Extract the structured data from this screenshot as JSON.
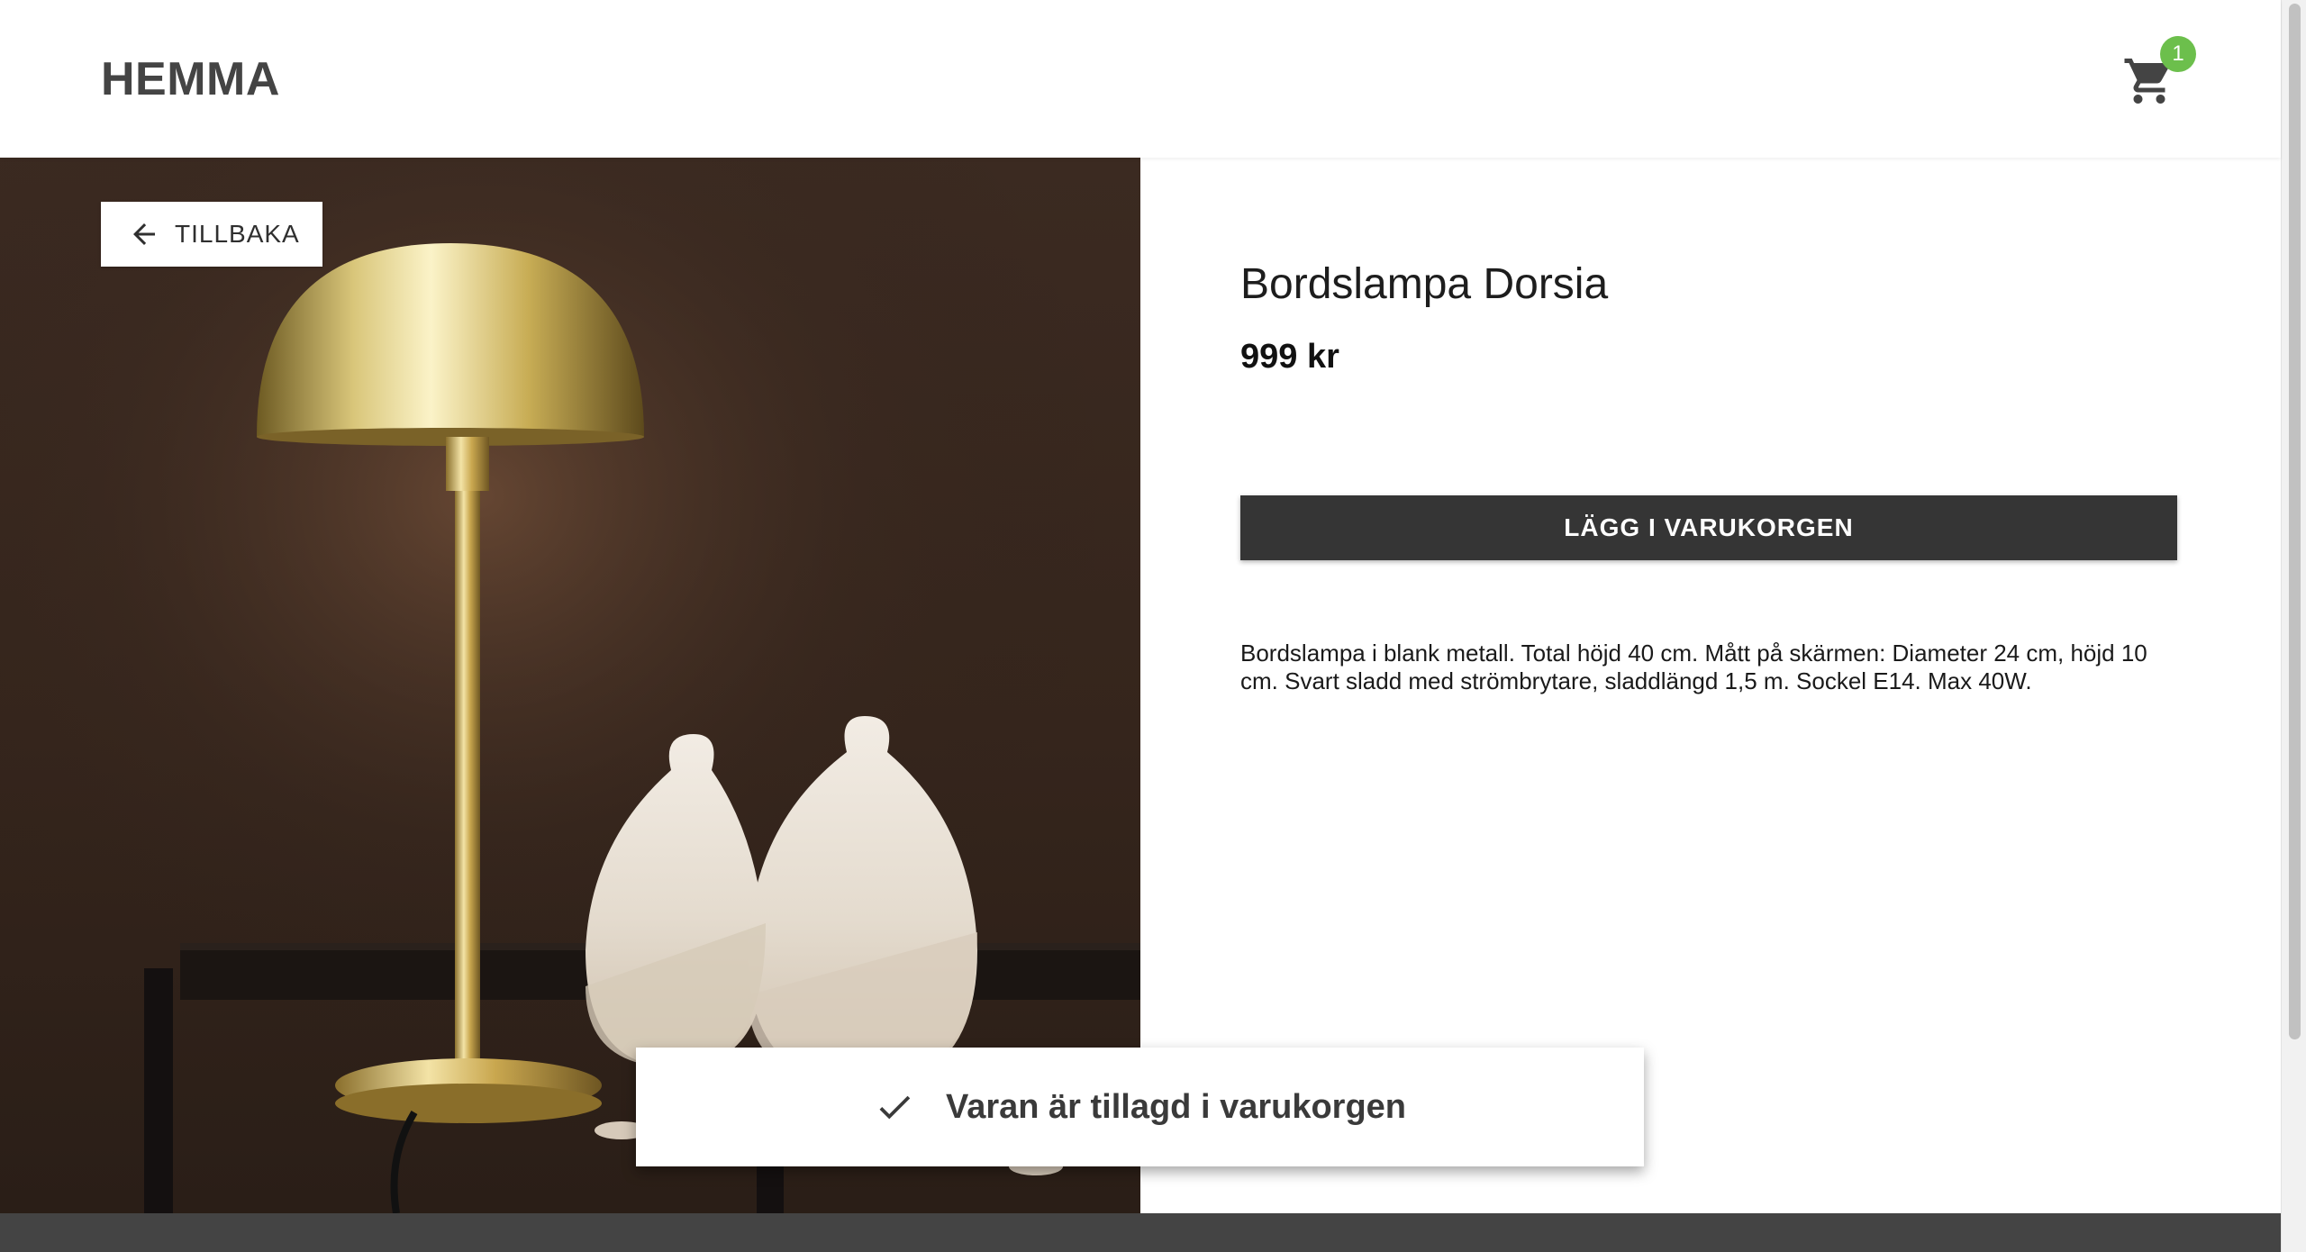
{
  "header": {
    "brand": "HEMMA",
    "cart_count": "1",
    "cart_icon": "shopping-cart-icon",
    "badge_color": "#6cbf4c"
  },
  "product": {
    "back_label": "TILLBAKA",
    "back_icon": "arrow-left-icon",
    "image_alt_icon": "product-photo",
    "title": "Bordslampa Dorsia",
    "price": "999 kr",
    "add_to_cart_label": "LÄGG I VARUKORGEN",
    "description": "Bordslampa i blank metall. Total höjd 40 cm. Mått på skärmen: Diameter 24 cm, höjd 10 cm. Svart sladd med strömbrytare, sladdlängd 1,5 m. Sockel E14. Max 40W."
  },
  "snackbar": {
    "icon": "check-icon",
    "message": "Varan är tillagd i varukorgen"
  },
  "colors": {
    "button_bg": "#353535",
    "footer_bg": "#444444",
    "text_dark": "#1d1d1d"
  }
}
